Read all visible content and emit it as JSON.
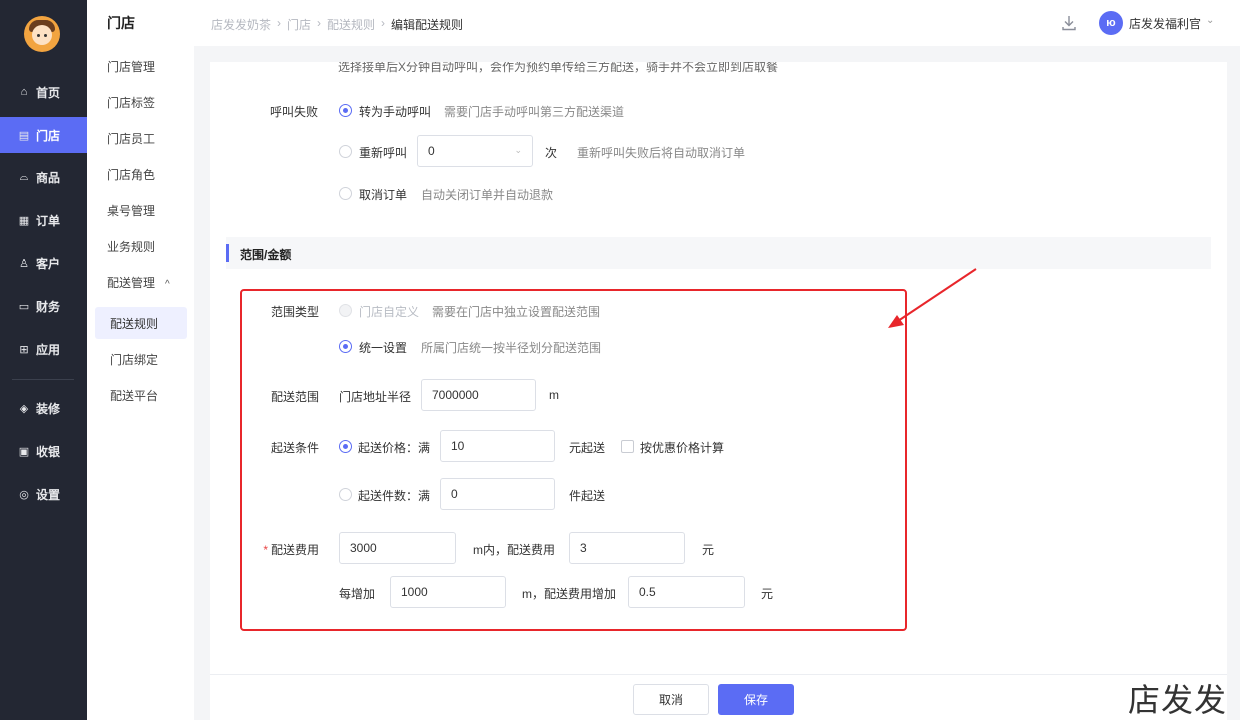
{
  "sidebar": {
    "items": [
      {
        "label": "首页",
        "icon": "home-icon",
        "glyph": "⌂"
      },
      {
        "label": "门店",
        "icon": "store-icon",
        "glyph": "▤"
      },
      {
        "label": "商品",
        "icon": "bag-icon",
        "glyph": "⌓"
      },
      {
        "label": "订单",
        "icon": "order-icon",
        "glyph": "▦"
      },
      {
        "label": "客户",
        "icon": "user-icon",
        "glyph": "♙"
      },
      {
        "label": "财务",
        "icon": "wallet-icon",
        "glyph": "▭"
      },
      {
        "label": "应用",
        "icon": "apps-icon",
        "glyph": "⊞"
      },
      {
        "label": "装修",
        "icon": "layers-icon",
        "glyph": "◈"
      },
      {
        "label": "收银",
        "icon": "cashier-icon",
        "glyph": "▣"
      },
      {
        "label": "设置",
        "icon": "settings-icon",
        "glyph": "◎"
      }
    ]
  },
  "submenu": {
    "title": "门店",
    "items": [
      "门店管理",
      "门店标签",
      "门店员工",
      "门店角色",
      "桌号管理",
      "业务规则"
    ],
    "group": {
      "label": "配送管理",
      "chevron": "^",
      "children": [
        "配送规则",
        "门店绑定",
        "配送平台"
      ]
    }
  },
  "header": {
    "breadcrumb": [
      "店发发奶茶",
      "门店",
      "配送规则",
      "编辑配送规则"
    ],
    "user_name": "店发发福利官",
    "user_chev": "⌄",
    "avatar_text": "ю"
  },
  "form": {
    "cut_text": "选择接单后X分钟自动呼叫，会作为预约单传给三方配送，骑手并不会立即到店取餐",
    "call_fail": {
      "label": "呼叫失败",
      "opt1": "转为手动呼叫",
      "opt1_hint": "需要门店手动呼叫第三方配送渠道",
      "opt2": "重新呼叫",
      "opt2_value": "0",
      "opt2_unit": "次",
      "opt2_hint": "重新呼叫失败后将自动取消订单",
      "opt3": "取消订单",
      "opt3_hint": "自动关闭订单并自动退款"
    },
    "section_title": "范围/金额",
    "range_type": {
      "label": "范围类型",
      "opt1": "门店自定义",
      "opt1_hint": "需要在门店中独立设置配送范围",
      "opt2": "统一设置",
      "opt2_hint": "所属门店统一按半径划分配送范围"
    },
    "delivery_range": {
      "label": "配送范围",
      "prefix": "门店地址半径",
      "value": "7000000",
      "unit": "m"
    },
    "start_condition": {
      "label": "起送条件",
      "opt1": "起送价格：满",
      "opt1_value": "10",
      "opt1_unit": "元起送",
      "discount_label": "按优惠价格计算",
      "opt2": "起送件数：满",
      "opt2_value": "0",
      "opt2_unit": "件起送"
    },
    "delivery_fee": {
      "required_mark": "*",
      "label": "配送费用",
      "distance_value": "3000",
      "distance_text": "m内，配送费用",
      "fee_value": "3",
      "fee_unit": "元",
      "each_label": "每增加",
      "each_value": "1000",
      "each_text": "m，配送费用增加",
      "each_fee_value": "0.5",
      "each_fee_unit": "元"
    }
  },
  "footer": {
    "cancel": "取消",
    "save": "保存"
  },
  "watermark": "店发发",
  "colors": {
    "accent": "#5b6cf4",
    "sidebar_bg": "#232733",
    "annotation_red": "#e8262b"
  }
}
